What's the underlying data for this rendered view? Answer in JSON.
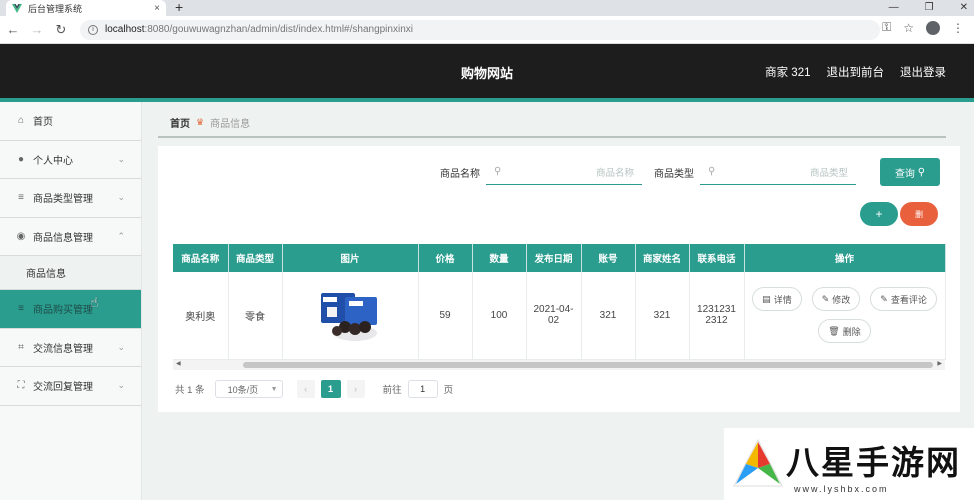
{
  "browser": {
    "tab_title": "后台管理系统",
    "url_host": "localhost",
    "url_path": ":8080/gouwuwagnzhan/admin/dist/index.html#/shangpinxinxi"
  },
  "header": {
    "site_title": "购物网站",
    "merchant_label": "商家 321",
    "back_to_front": "退出到前台",
    "logout": "退出登录"
  },
  "sidebar": {
    "items": [
      {
        "label": "首页",
        "icon": "home-icon"
      },
      {
        "label": "个人中心",
        "icon": "user-icon"
      },
      {
        "label": "商品类型管理",
        "icon": "menu-icon"
      },
      {
        "label": "商品信息管理",
        "icon": "location-icon"
      },
      {
        "label": "商品信息",
        "icon": ""
      },
      {
        "label": "商品购买管理",
        "icon": "menu-icon"
      },
      {
        "label": "交流信息管理",
        "icon": "crop-icon"
      },
      {
        "label": "交流回复管理",
        "icon": "fullscreen-icon"
      }
    ]
  },
  "breadcrumb": {
    "home": "首页",
    "current": "商品信息"
  },
  "search": {
    "name_label": "商品名称",
    "name_placeholder": "商品名称",
    "type_label": "商品类型",
    "type_placeholder": "商品类型",
    "query_button": "查询"
  },
  "actions": {
    "add": "+",
    "delete": "删"
  },
  "table": {
    "headers": [
      "商品名称",
      "商品类型",
      "图片",
      "价格",
      "数量",
      "发布日期",
      "账号",
      "商家姓名",
      "联系电话",
      "操作"
    ],
    "rows": [
      {
        "name": "奥利奥",
        "type": "零食",
        "price": "59",
        "quantity": "100",
        "date": "2021-04-02",
        "account": "321",
        "merchant": "321",
        "phone": "12312312312",
        "ops": [
          "详情",
          "修改",
          "查看评论",
          "删除"
        ]
      }
    ]
  },
  "pagination": {
    "total": "共 1 条",
    "page_size": "10条/页",
    "current_page": "1",
    "goto_label": "前往",
    "goto_value": "1",
    "page_unit": "页"
  },
  "watermark": {
    "text": "八星手游网",
    "url": "www.lyshbx.com"
  },
  "colors": {
    "accent": "#2a9d8f",
    "danger": "#e8603c",
    "header": "#1d1d1d"
  }
}
